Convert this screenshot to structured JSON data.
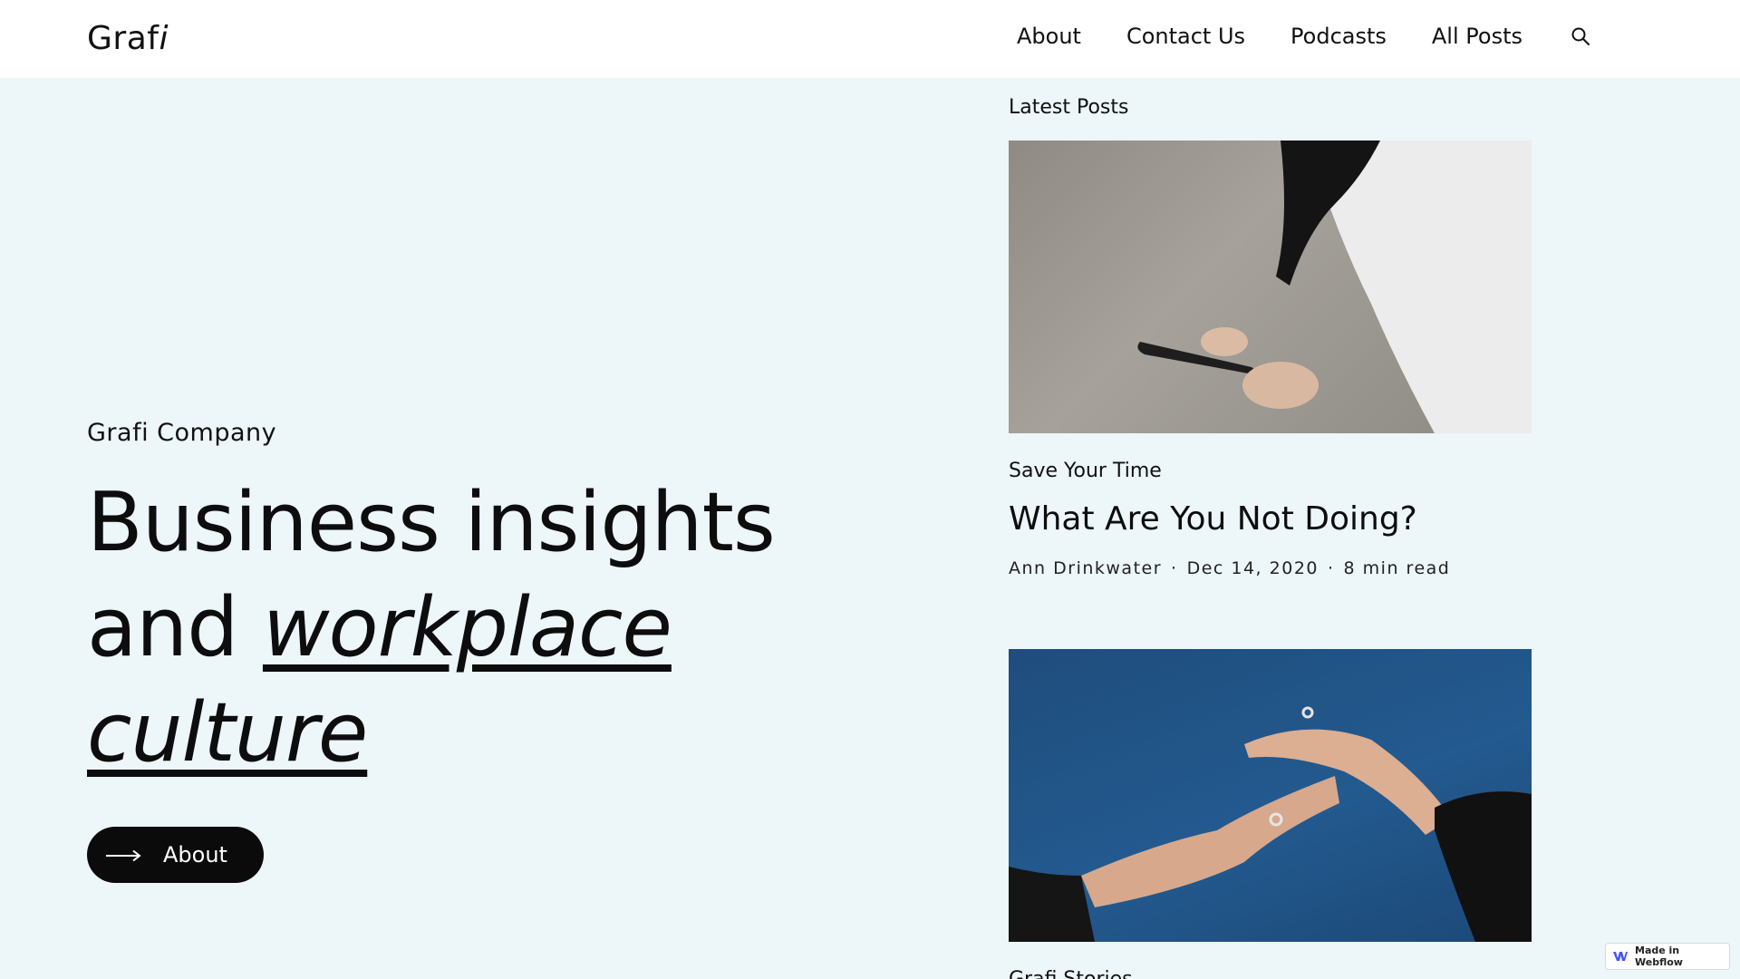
{
  "header": {
    "logo_plain": "Graf",
    "logo_italic": "i",
    "nav": [
      {
        "label": "About"
      },
      {
        "label": "Contact Us"
      },
      {
        "label": "Podcasts"
      },
      {
        "label": "All Posts"
      }
    ],
    "search_icon": "search-icon"
  },
  "hero": {
    "eyebrow": "Grafi Company",
    "headline_line1": "Business insights",
    "headline_and": "and ",
    "headline_em1": "workplace",
    "headline_em2": "culture",
    "button_label": "About",
    "button_icon": "arrow-right-icon"
  },
  "latest": {
    "section_label": "Latest Posts",
    "posts": [
      {
        "tag": "Save Your Time",
        "title": "What Are You Not Doing?",
        "author": "Ann Drinkwater",
        "date": "Dec 14, 2020",
        "read_time": "8 min read"
      },
      {
        "tag": "Grafi Stories"
      }
    ]
  },
  "badge": {
    "label": "Made in Webflow",
    "icon": "webflow-icon",
    "color": "#4353ff"
  }
}
